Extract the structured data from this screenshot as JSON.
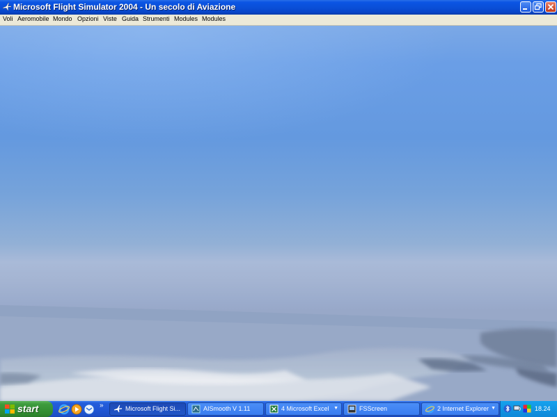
{
  "window": {
    "title": "Microsoft Flight Simulator 2004 - Un secolo di Aviazione",
    "icon": "airplane-icon",
    "buttons": [
      "minimize-icon",
      "restore-icon",
      "close-icon"
    ]
  },
  "menu": {
    "items": [
      "Voli",
      "Aeromobile",
      "Mondo",
      "Opzioni",
      "Viste",
      "Guida",
      "Strumenti",
      "Modules",
      "Modules"
    ]
  },
  "taskbar": {
    "start_label": "start",
    "quick_launch": [
      "internet-explorer-icon",
      "media-player-icon",
      "outlook-express-icon"
    ],
    "quick_launch_more": "»",
    "tasks": [
      {
        "label": "Microsoft Flight Si...",
        "icon": "airplane-icon",
        "active": true
      },
      {
        "label": "AISmooth V 1.11",
        "icon": "app-icon",
        "active": false
      },
      {
        "label": "4 Microsoft Excel",
        "icon": "excel-icon",
        "active": false,
        "group": true
      },
      {
        "label": "FSScreen",
        "icon": "app-icon",
        "active": false
      },
      {
        "label": "2 Internet Explorer",
        "icon": "internet-explorer-icon",
        "active": false,
        "group": true
      }
    ],
    "tray_icons": [
      "bluetooth-icon",
      "network-icon",
      "security-icon"
    ],
    "clock": "18.24"
  },
  "colors": {
    "titlebar": "#0a4fd8",
    "menubar": "#ece9d8",
    "taskbar": "#245edb",
    "start": "#3d9b3d",
    "tray": "#0e88d8",
    "sky_top": "#7ba8e6",
    "horizon": "#a9bad8",
    "ground": "#98a8c8"
  }
}
